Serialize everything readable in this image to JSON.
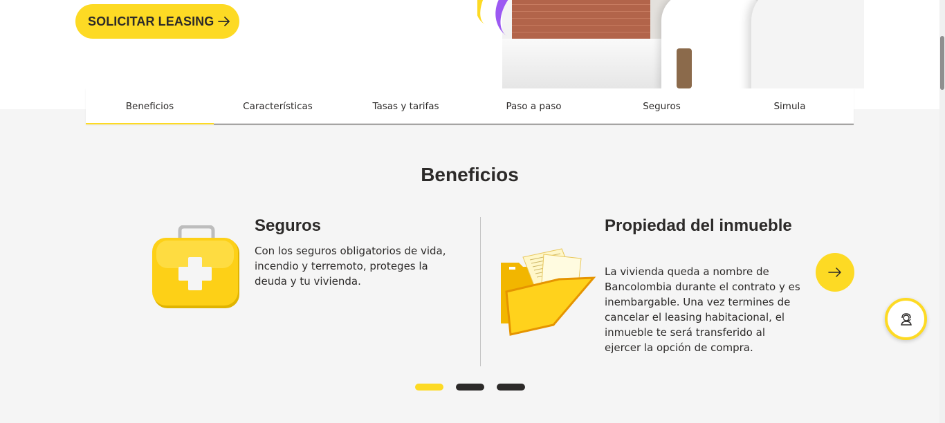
{
  "cta": {
    "label": "SOLICITAR LEASING"
  },
  "tabs": [
    {
      "label": "Beneficios",
      "active": true
    },
    {
      "label": "Características",
      "active": false
    },
    {
      "label": "Tasas y tarifas",
      "active": false
    },
    {
      "label": "Paso a paso",
      "active": false
    },
    {
      "label": "Seguros",
      "active": false
    },
    {
      "label": "Simula",
      "active": false
    }
  ],
  "section": {
    "title": "Beneficios"
  },
  "cards": [
    {
      "title": "Seguros",
      "text": "Con los seguros obligatorios de vida, incendio y terremoto, proteges la deuda y tu vivienda.",
      "icon": "first-aid-kit-icon"
    },
    {
      "title": "Propiedad del inmueble",
      "text": "La vivienda queda a nombre de Bancolombia durante el contrato y es inembargable. Una vez termines de cancelar el leasing habitacional, el inmueble te será transferido al ejercer la opción de compra.",
      "icon": "folder-documents-icon"
    }
  ],
  "carousel": {
    "active_index": 0,
    "count": 3
  },
  "colors": {
    "brand_yellow": "#fdda24",
    "text": "#2c2a29",
    "background": "#f5f5f5",
    "accent_purple": "#9c59f2"
  }
}
